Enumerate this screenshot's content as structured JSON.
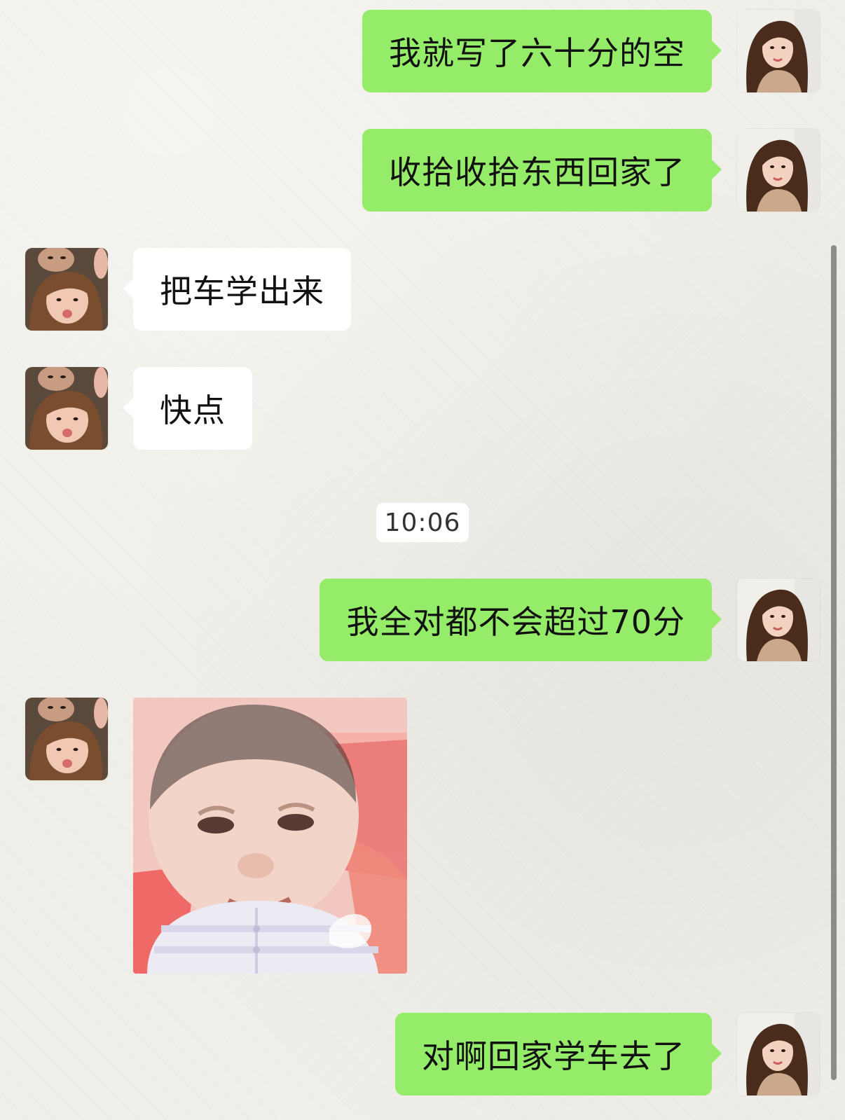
{
  "conversation": {
    "messages": [
      {
        "side": "right",
        "type": "text",
        "text": "我就写了六十分的空",
        "avatar": "girl-avatar-icon"
      },
      {
        "side": "right",
        "type": "text",
        "text": "收拾收拾东西回家了",
        "avatar": "girl-avatar-icon"
      },
      {
        "side": "left",
        "type": "text",
        "text": "把车学出来",
        "avatar": "friend-avatar-icon"
      },
      {
        "side": "left",
        "type": "text",
        "text": "快点",
        "avatar": "friend-avatar-icon"
      },
      {
        "type": "timestamp",
        "text": "10:06"
      },
      {
        "side": "right",
        "type": "text",
        "text": "我全对都不会超过70分",
        "avatar": "girl-avatar-icon"
      },
      {
        "side": "left",
        "type": "sticker",
        "sticker": "smiling-baby-sticker",
        "avatar": "friend-avatar-icon"
      },
      {
        "side": "right",
        "type": "text",
        "text": "对啊回家学车去了",
        "avatar": "girl-avatar-icon"
      }
    ]
  },
  "colors": {
    "outgoing_bubble": "#95ec69",
    "incoming_bubble": "#ffffff",
    "background": "#efeee8",
    "scrollbar": "#8c8c8c"
  },
  "icons": {
    "self_avatar": "girl-avatar-icon",
    "friend_avatar": "friend-avatar-icon",
    "sticker": "smiling-baby-sticker"
  }
}
